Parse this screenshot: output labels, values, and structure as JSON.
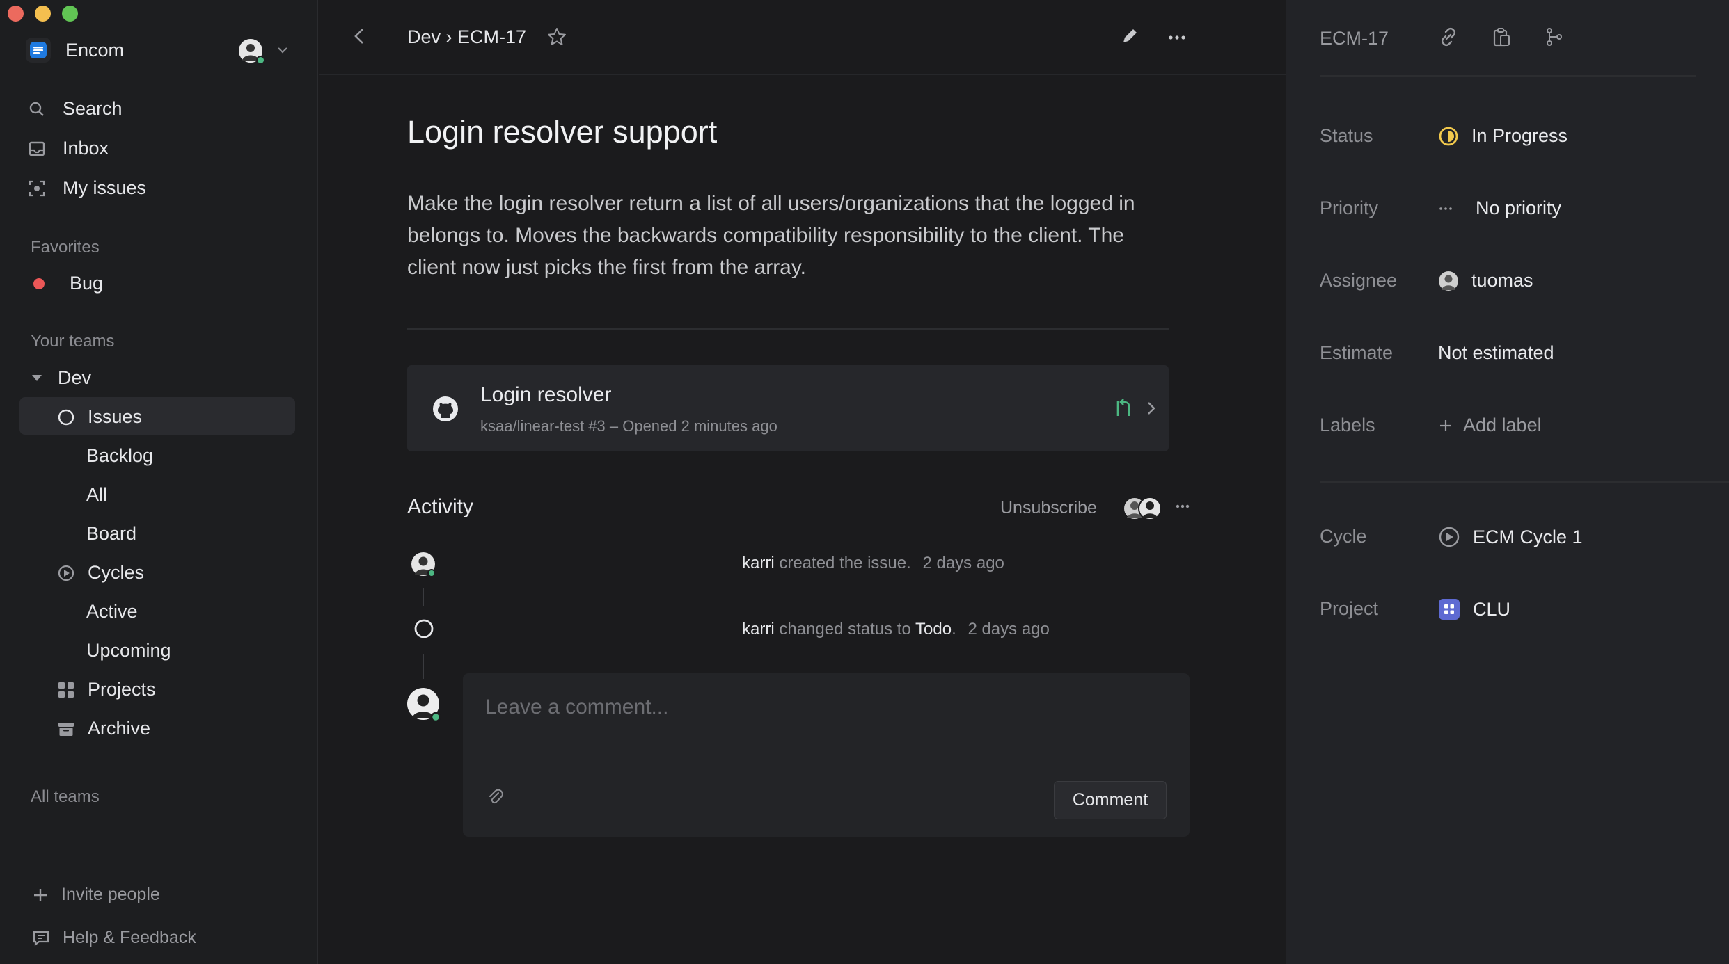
{
  "window": {
    "traffic_colors": [
      "#ec6a5e",
      "#f4bf4f",
      "#61c554"
    ]
  },
  "sidebar": {
    "workspace_name": "Encom",
    "nav": [
      {
        "label": "Search",
        "icon": "search-icon"
      },
      {
        "label": "Inbox",
        "icon": "inbox-icon"
      },
      {
        "label": "My issues",
        "icon": "my-issues-icon"
      }
    ],
    "favorites_label": "Favorites",
    "favorites": [
      {
        "label": "Bug",
        "color": "#eb5757"
      }
    ],
    "teams_label": "Your teams",
    "team": {
      "name": "Dev",
      "issues_label": "Issues",
      "issues_children": [
        "Backlog",
        "All",
        "Board"
      ],
      "cycles_label": "Cycles",
      "cycles_children": [
        "Active",
        "Upcoming"
      ],
      "projects_label": "Projects",
      "archive_label": "Archive"
    },
    "all_teams_label": "All teams",
    "invite_label": "Invite people",
    "help_label": "Help & Feedback"
  },
  "main": {
    "breadcrumb": "Dev › ECM-17",
    "title": "Login resolver support",
    "description": "Make the login resolver return a list of all users/organizations that the logged in belongs to. Moves the backwards compatibility responsibility to the client. The client now just picks the first from the array.",
    "pr": {
      "title": "Login resolver",
      "subtitle": "ksaa/linear-test #3 – Opened 2 minutes ago"
    },
    "activity": {
      "title": "Activity",
      "unsubscribe_label": "Unsubscribe",
      "events": [
        {
          "user": "karri",
          "text": "created the issue.",
          "time": "2 days ago"
        },
        {
          "user": "karri",
          "text": "changed status to",
          "target": "Todo",
          "suffix": ".",
          "time": "2 days ago"
        }
      ],
      "comment_placeholder": "Leave a comment...",
      "comment_button": "Comment"
    }
  },
  "details": {
    "issue_id": "ECM-17",
    "status": {
      "label": "Status",
      "value": "In Progress",
      "color": "#f2c94c"
    },
    "priority": {
      "label": "Priority",
      "value": "No priority"
    },
    "assignee": {
      "label": "Assignee",
      "value": "tuomas"
    },
    "estimate": {
      "label": "Estimate",
      "value": "Not estimated"
    },
    "labels": {
      "label": "Labels",
      "value": "Add label"
    },
    "cycle": {
      "label": "Cycle",
      "value": "ECM Cycle 1"
    },
    "project": {
      "label": "Project",
      "value": "CLU",
      "color": "#5e6ad2"
    }
  }
}
